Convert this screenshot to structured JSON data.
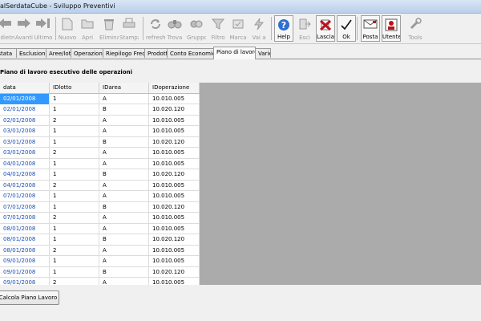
{
  "window": {
    "title": "alSerdataCube - Sviluppo Preventivi"
  },
  "toolbar": {
    "buttons": [
      {
        "label": "Indietro",
        "icon": "arrow-left-icon",
        "enabled": false
      },
      {
        "label": "Avanti",
        "icon": "arrow-right-icon",
        "enabled": false
      },
      {
        "label": "Ultimo",
        "icon": "arrow-last-icon",
        "enabled": false
      },
      {
        "label": "Nuovo",
        "icon": "new-document-icon",
        "enabled": false
      },
      {
        "label": "Apri",
        "icon": "open-icon",
        "enabled": false
      },
      {
        "label": "Elimina",
        "icon": "delete-icon",
        "enabled": false
      },
      {
        "label": "Stampa",
        "icon": "print-icon",
        "enabled": false
      },
      {
        "label": "refresh",
        "icon": "refresh-icon",
        "enabled": false
      },
      {
        "label": "Trova",
        "icon": "binoculars-icon",
        "enabled": false
      },
      {
        "label": "Gruppo",
        "icon": "group-icon",
        "enabled": false
      },
      {
        "label": "Filtro",
        "icon": "filter-icon",
        "enabled": false
      },
      {
        "label": "Marca",
        "icon": "mark-icon",
        "enabled": false
      },
      {
        "label": "Vai a",
        "icon": "goto-icon",
        "enabled": false
      },
      {
        "label": "Help",
        "icon": "help-icon",
        "enabled": true
      },
      {
        "label": "Esci",
        "icon": "exit-icon",
        "enabled": false
      },
      {
        "label": "Lascia",
        "icon": "cancel-x-icon",
        "enabled": true
      },
      {
        "label": "Ok",
        "icon": "checkmark-icon",
        "enabled": true
      },
      {
        "label": "Posta",
        "icon": "mail-icon",
        "enabled": true
      },
      {
        "label": "Utente",
        "icon": "user-icon",
        "enabled": true
      },
      {
        "label": "Tools",
        "icon": "tools-icon",
        "enabled": false
      }
    ]
  },
  "tabs": [
    {
      "label": "Testata"
    },
    {
      "label": "Esclusioni"
    },
    {
      "label": "Aree/lotti"
    },
    {
      "label": "Operazioni"
    },
    {
      "label": "Riepilogo Freq."
    },
    {
      "label": "Prodotti"
    },
    {
      "label": "Conto Economico"
    },
    {
      "label": "Piano di lavoro",
      "active": true
    },
    {
      "label": "Varie"
    }
  ],
  "section_title": "Piano di lavoro esecutivo delle operazioni",
  "grid": {
    "columns": [
      "data",
      "IDlotto",
      "IDarea",
      "IDoperazione"
    ],
    "rows": [
      [
        "02/01/2008",
        "1",
        "A",
        "10.010.005"
      ],
      [
        "02/01/2008",
        "1",
        "B",
        "10.020.120"
      ],
      [
        "02/01/2008",
        "2",
        "A",
        "10.010.005"
      ],
      [
        "03/01/2008",
        "1",
        "A",
        "10.010.005"
      ],
      [
        "03/01/2008",
        "1",
        "B",
        "10.020.120"
      ],
      [
        "03/01/2008",
        "2",
        "A",
        "10.010.005"
      ],
      [
        "04/01/2008",
        "1",
        "A",
        "10.010.005"
      ],
      [
        "04/01/2008",
        "1",
        "B",
        "10.020.120"
      ],
      [
        "04/01/2008",
        "2",
        "A",
        "10.010.005"
      ],
      [
        "07/01/2008",
        "1",
        "A",
        "10.010.005"
      ],
      [
        "07/01/2008",
        "1",
        "B",
        "10.020.120"
      ],
      [
        "07/01/2008",
        "2",
        "A",
        "10.010.005"
      ],
      [
        "08/01/2008",
        "1",
        "A",
        "10.010.005"
      ],
      [
        "08/01/2008",
        "1",
        "B",
        "10.020.120"
      ],
      [
        "08/01/2008",
        "2",
        "A",
        "10.010.005"
      ],
      [
        "09/01/2008",
        "1",
        "A",
        "10.010.005"
      ],
      [
        "09/01/2008",
        "1",
        "B",
        "10.020.120"
      ],
      [
        "09/01/2008",
        "2",
        "A",
        "10.010.005"
      ]
    ]
  },
  "bottom_button": {
    "label": "Calcola Piano Lavoro"
  },
  "colors": {
    "selection": "#3399ff",
    "grid_background": "#ababab",
    "link_text": "#1a4fb5"
  }
}
